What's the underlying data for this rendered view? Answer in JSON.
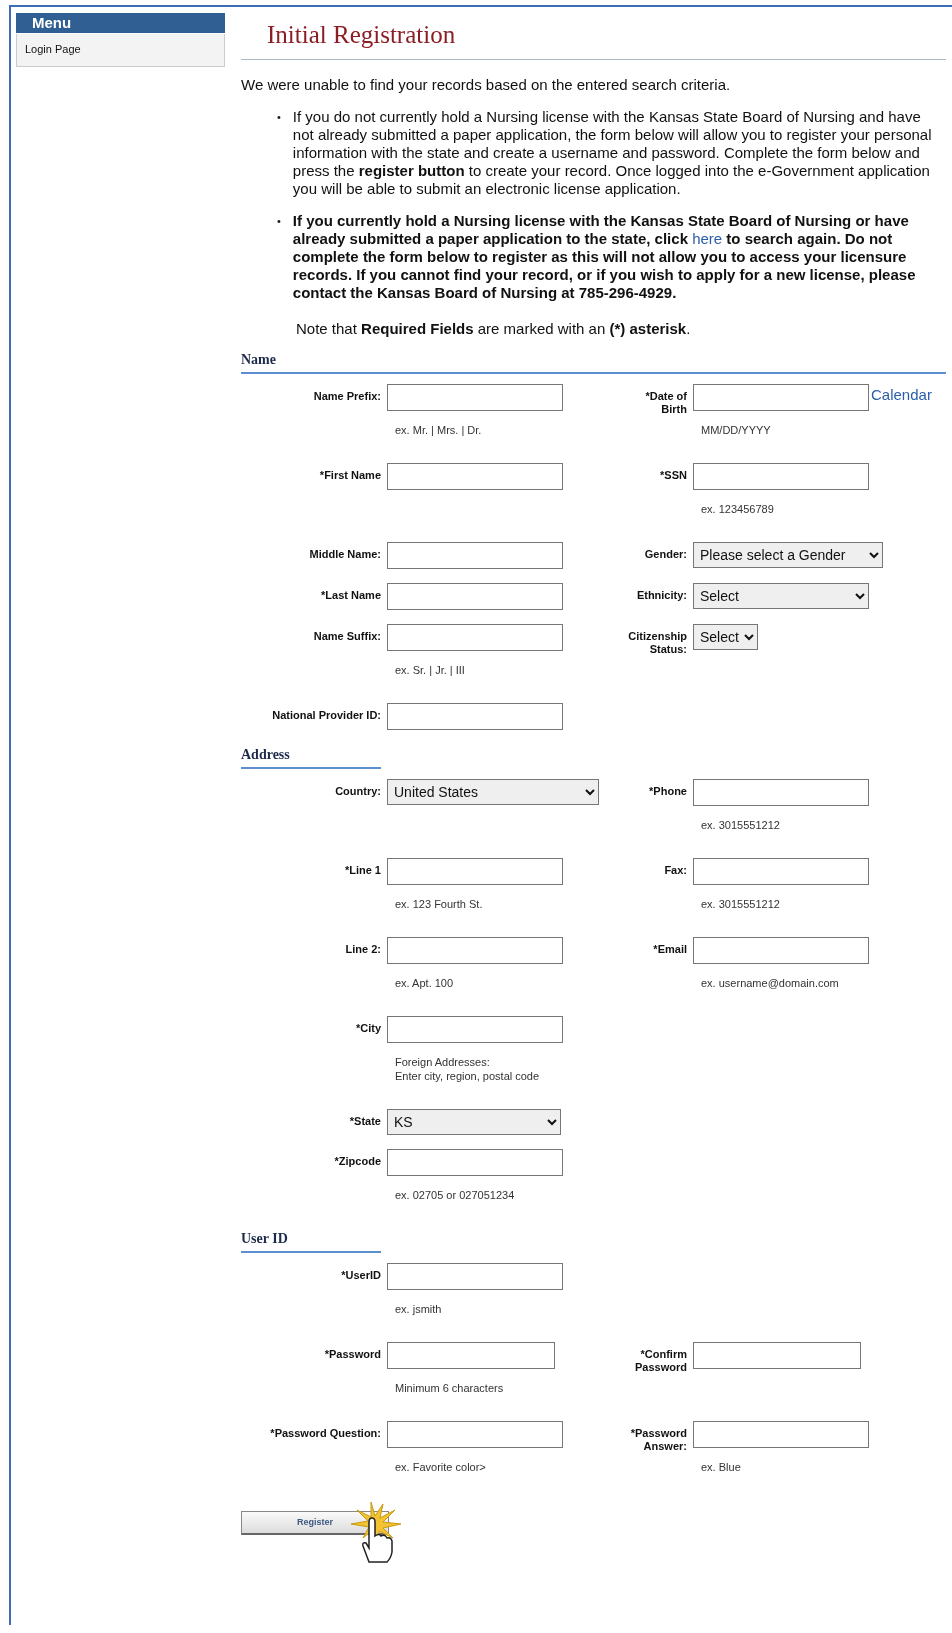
{
  "sidebar": {
    "header": "Menu",
    "items": [
      {
        "label": "Login Page"
      }
    ]
  },
  "title": "Initial Registration",
  "intro": "We were unable to find your records based on the entered search criteria.",
  "bullets": [
    {
      "kind": "plain",
      "marker": "•",
      "text": "If you do not currently hold a Nursing license with the Kansas State Board of Nursing and have not already submitted a paper application, the form below will allow you to register your personal information with the state and create a username and password. Complete the form below and press the **register button** to create your record. Once logged into the e-Government application you will be able to submit an electronic license application."
    },
    {
      "kind": "emphasis",
      "marker": "•",
      "text": "If you currently hold a Nursing license with the Kansas State Board of Nursing or have already submitted a paper application to the state, click ",
      "link": "here",
      "text_after": " to search again. Do not complete the form below to register as this will not allow you to access your licensure records. If you cannot find your record, or if you wish to apply for a new license, please contact the Kansas Board of Nursing at 785-296-4929."
    }
  ],
  "note": "Note that **Required Fields** are marked with an **(*) asterisk**.",
  "sections": [
    {
      "title": "Name",
      "rows": [
        {
          "left": {
            "label": "Name Prefix:",
            "kind": "text",
            "hints": [
              "ex. Mr. | Mrs. | Dr."
            ]
          },
          "right": {
            "label": "*Date of Birth",
            "kind": "text",
            "link": "Calendar",
            "hints": [
              "MM/DD/YYYY"
            ]
          }
        },
        {
          "left": {
            "label": "*First Name",
            "kind": "text"
          },
          "right": {
            "label": "*SSN",
            "kind": "text",
            "hints": [
              "ex. 123456789"
            ]
          }
        },
        {
          "left": {
            "label": "Middle Name:",
            "kind": "text"
          },
          "right": {
            "label": "Gender:",
            "kind": "select",
            "value": "Please select a Gender"
          }
        },
        {
          "left": {
            "label": "*Last Name",
            "kind": "text"
          },
          "right": {
            "label": "Ethnicity:",
            "kind": "select",
            "value": "Select"
          }
        },
        {
          "left": {
            "label": "Name Suffix:",
            "kind": "text",
            "hints": [
              "ex. Sr. | Jr. | III"
            ]
          },
          "right": {
            "label": "Citizenship Status:",
            "kind": "select",
            "value": "Select"
          }
        },
        {
          "left": {
            "label": "National Provider ID:",
            "kind": "text"
          }
        }
      ]
    },
    {
      "title": "Address",
      "rows": [
        {
          "left": {
            "label": "Country:",
            "kind": "select",
            "value": "United States"
          },
          "right": {
            "label": "*Phone",
            "kind": "text",
            "hints": [
              "ex. 3015551212"
            ]
          }
        },
        {
          "left": {
            "label": "*Line 1",
            "kind": "text",
            "hints": [
              "ex. 123 Fourth St."
            ]
          },
          "right": {
            "label": "Fax:",
            "kind": "text",
            "hints": [
              "ex. 3015551212"
            ]
          }
        },
        {
          "left": {
            "label": "Line 2:",
            "kind": "text",
            "hints": [
              "ex. Apt. 100"
            ]
          },
          "right": {
            "label": "*Email",
            "kind": "text",
            "hints": [
              "ex. username@domain.com"
            ]
          }
        },
        {
          "left": {
            "label": "*City",
            "kind": "text",
            "hints": [
              "Foreign Addresses:",
              "Enter city, region, postal code"
            ]
          }
        },
        {
          "left": {
            "label": "*State",
            "kind": "select",
            "value": "KS"
          }
        },
        {
          "left": {
            "label": "*Zipcode",
            "kind": "text",
            "hints": [
              "ex. 02705 or 027051234"
            ]
          }
        }
      ]
    },
    {
      "title": "User ID",
      "rows": [
        {
          "left": {
            "label": "*UserID",
            "kind": "text",
            "hints": [
              "ex. jsmith"
            ]
          }
        },
        {
          "left": {
            "label": "*Password",
            "kind": "password",
            "hints": [
              "Minimum 6 characters"
            ]
          },
          "right": {
            "label": "*Confirm Password",
            "kind": "password"
          }
        },
        {
          "left": {
            "label": "*Password Question:",
            "kind": "text",
            "hints": [
              "ex. Favorite color>"
            ]
          },
          "right": {
            "label": "*Password Answer:",
            "kind": "text",
            "hints": [
              "ex. Blue"
            ]
          }
        }
      ]
    }
  ],
  "register": {
    "label": "Register"
  }
}
